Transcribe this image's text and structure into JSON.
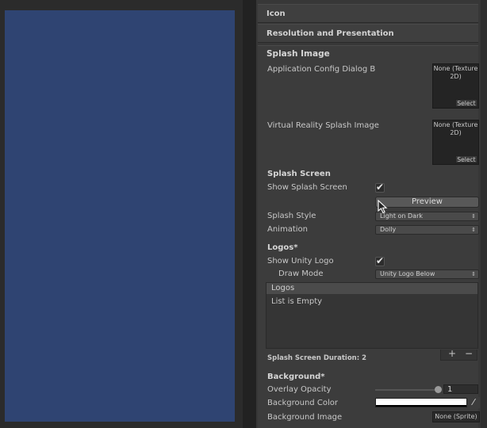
{
  "foldouts": {
    "icon": "Icon",
    "resolution": "Resolution and Presentation",
    "splash_image": "Splash Image"
  },
  "splash_image": {
    "app_config_label": "Application Config Dialog B",
    "vr_splash_label": "Virtual Reality Splash Image",
    "texture_none": "None (Texture 2D)",
    "select_label": "Select"
  },
  "splash_screen": {
    "header": "Splash Screen",
    "show_label": "Show Splash Screen",
    "show_checked": true,
    "preview_label": "Preview",
    "style_label": "Splash Style",
    "style_value": "Light on Dark",
    "animation_label": "Animation",
    "animation_value": "Dolly"
  },
  "logos": {
    "header": "Logos*",
    "show_unity_label": "Show Unity Logo",
    "show_unity_checked": true,
    "draw_mode_label": "Draw Mode",
    "draw_mode_value": "Unity Logo Below",
    "list_header": "Logos",
    "list_empty": "List is Empty",
    "duration_label": "Splash Screen Duration: 2",
    "add": "+",
    "remove": "−"
  },
  "background": {
    "header": "Background*",
    "overlay_label": "Overlay Opacity",
    "overlay_value": "1",
    "color_label": "Background Color",
    "color_value": "#ffffff",
    "image_label": "Background Image",
    "image_value": "None (Sprite)"
  },
  "colors": {
    "game_view": "#2f4472",
    "inspector_bg": "#3c3c3c"
  },
  "icons": [
    "checkmark-icon",
    "dropdown-arrow-icon",
    "eyedropper-icon",
    "plus-icon",
    "minus-icon",
    "mouse-cursor-icon"
  ]
}
